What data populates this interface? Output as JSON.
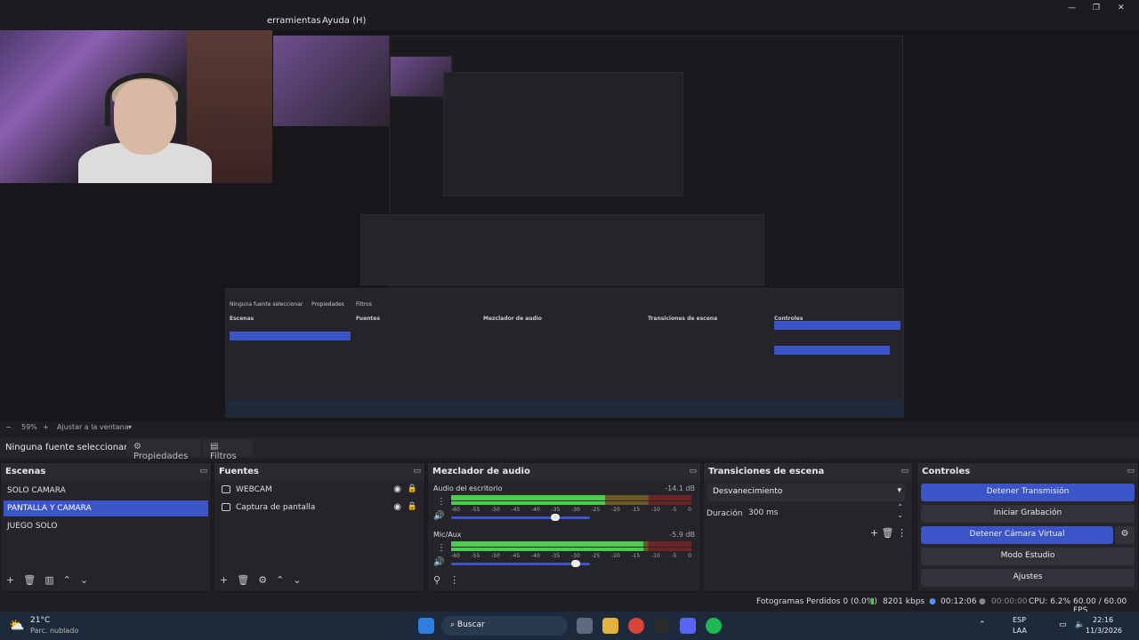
{
  "menu": {
    "item_tools": "erramientas",
    "item_help": "Ayuda (H)"
  },
  "window": {
    "minimize": "—",
    "maximize": "❐",
    "close": "✕"
  },
  "preview": {
    "nested_scene_label": "Ninguna fuente seleccionar",
    "nested_props": "Propiedades",
    "nested_filters": "Filtros",
    "nested_scenes_header": "Escenas",
    "nested_sources_header": "Fuentes",
    "nested_mixer_header": "Mezclador de audio",
    "nested_transitions_header": "Transiciones de escena",
    "nested_controls_header": "Controles"
  },
  "zoombar": {
    "minus": "−",
    "zoom": "59%",
    "plus": "+",
    "fit": "Ajustar a la ventana"
  },
  "propsbar": {
    "no_source": "Ninguna fuente seleccionar",
    "properties": "Propiedades",
    "filters": "Filtros"
  },
  "scenes": {
    "header": "Escenas",
    "items": [
      "SOLO CAMARA",
      "PANTALLA Y CAMARA",
      "JUEGO SOLO"
    ],
    "selected_index": 1
  },
  "sources": {
    "header": "Fuentes",
    "items": [
      {
        "label": "WEBCAM"
      },
      {
        "label": "Captura de pantalla"
      }
    ]
  },
  "mixer": {
    "header": "Mezclador de audio",
    "channels": [
      {
        "name": "Audio del escritorio",
        "db": "-14.1 dB",
        "level": 0.64,
        "volume": 0.75
      },
      {
        "name": "Mic/Aux",
        "db": "-5.9 dB",
        "level": 0.8,
        "volume": 0.9
      }
    ],
    "scale": [
      "-60",
      "-55",
      "-50",
      "-45",
      "-40",
      "-35",
      "-30",
      "-25",
      "-20",
      "-15",
      "-10",
      "-5",
      "0"
    ]
  },
  "transitions": {
    "header": "Transiciones de escena",
    "selected": "Desvanecimiento",
    "duration_label": "Duración",
    "duration_value": "300 ms"
  },
  "controls": {
    "header": "Controles",
    "buttons": [
      "Detener Transmisión",
      "Iniciar Grabación",
      "Detener Cámara Virtual",
      "Modo Estudio",
      "Ajustes"
    ]
  },
  "status": {
    "dropped": "Fotogramas Perdidos 0 (0.0%)",
    "bitrate": "8201 kbps",
    "stream_time": "00:12:06",
    "rec_time": "00:00:00",
    "cpu": "CPU: 6.2%",
    "fps": "60.00 / 60.00 FPS"
  },
  "taskbar": {
    "weather_temp": "21°C",
    "weather_desc": "Parc. nublado",
    "search": "Buscar",
    "lang": "ESP",
    "lang2": "LAA",
    "time": "22:16",
    "date": "11/3/2026"
  },
  "colors": {
    "accent": "#3b55c9",
    "panel_bg": "#25242a",
    "taskbar_bg": "#1c2a3b"
  }
}
